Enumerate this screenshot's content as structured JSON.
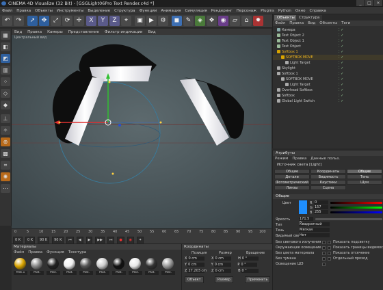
{
  "window": {
    "title": "CINEMA 4D Visualize (32 Bit) - [GSGLight06Pro Text Render.c4d *]",
    "buttons": [
      "_",
      "□",
      "×"
    ]
  },
  "menubar": [
    "Файл",
    "Правка",
    "Объекты",
    "Инструменты",
    "Выделение",
    "Структура",
    "Функции",
    "Анимация",
    "Симуляция",
    "Рендеринг",
    "Персонаж",
    "Plugins",
    "Python",
    "Окно",
    "Справка"
  ],
  "toolbar": {
    "icons": [
      "undo-icon",
      "redo-icon",
      "select-icon",
      "move-icon",
      "scale-icon",
      "rotate-icon",
      "recent-icon",
      "x-axis-icon",
      "y-axis-icon",
      "z-axis-icon",
      "coord-icon",
      "render-region-icon",
      "render-view-icon",
      "render-settings-icon",
      "cube-icon",
      "pen-icon",
      "subdiv-icon",
      "array-icon",
      "deformer-icon",
      "floor-icon",
      "camera-icon",
      "light-icon"
    ],
    "axis_labels": [
      "X",
      "Y",
      "Z"
    ]
  },
  "left_tools": [
    "make-editable-icon",
    "model-mode-icon",
    "texture-mode-icon",
    "workplane-icon",
    "points-icon",
    "edges-icon",
    "polygons-icon",
    "axis-icon",
    "tweak-icon",
    "snap-icon",
    "solo-icon",
    "quantize-icon",
    "live-select-icon",
    "misc-icon"
  ],
  "viewport": {
    "menu": [
      "Вид",
      "Правка",
      "Камеры",
      "Представление",
      "Фильтр индикации",
      "Вид"
    ],
    "label": "Центральный вид"
  },
  "timeline": {
    "ticks": [
      "0",
      "5",
      "10",
      "15",
      "20",
      "25",
      "30",
      "35",
      "40",
      "45",
      "50",
      "55",
      "60",
      "65",
      "70",
      "75",
      "80",
      "85",
      "90",
      "95",
      "100"
    ],
    "start": "0 K",
    "current": "0 K",
    "end": "90 K",
    "end2": "90 K"
  },
  "materials": {
    "title": "Материалы",
    "menu": [
      "Файл",
      "Правка",
      "Функция",
      "Текстура"
    ],
    "items": [
      {
        "name": "Mat.1",
        "color": "#d9a400"
      },
      {
        "name": "Mat.",
        "color": "#888888"
      },
      {
        "name": "Mat.",
        "color": "#222222"
      },
      {
        "name": "Mat.",
        "color": "#f0f0f0"
      },
      {
        "name": "Mat.",
        "color": "#555555"
      },
      {
        "name": "Mat.",
        "color": "#cccccc"
      },
      {
        "name": "Mat.",
        "color": "#111111"
      },
      {
        "name": "Mat.",
        "color": "#e8e8e8"
      },
      {
        "name": "Mat.",
        "color": "#333333"
      },
      {
        "name": "Mat.",
        "color": "#999999"
      }
    ]
  },
  "coordinates": {
    "title": "Координаты",
    "columns": [
      "Позиция",
      "Размер",
      "Вращение"
    ],
    "rows": [
      {
        "axis": "X",
        "pos": "0 cm",
        "size": "0 cm",
        "rot_axis": "H",
        "rot": "0 °"
      },
      {
        "axis": "Y",
        "pos": "0 cm",
        "size": "0 cm",
        "rot_axis": "P",
        "rot": "0 °"
      },
      {
        "axis": "Z",
        "pos": "27.203 cm",
        "size": "0 cm",
        "rot_axis": "B",
        "rot": "0 °"
      }
    ],
    "mode1": "Объект",
    "mode2": "Размер",
    "apply": "Применить"
  },
  "objects": {
    "tabs": [
      "Объекты",
      "Структура"
    ],
    "menu": [
      "Файл",
      "Правка",
      "Вид",
      "Объекты",
      "Теги"
    ],
    "rows": [
      {
        "name": "Камера",
        "indent": 0,
        "color": "#8aa"
      },
      {
        "name": "Text Object 2",
        "indent": 0,
        "color": "#9b9"
      },
      {
        "name": "Text Object 1",
        "indent": 0,
        "color": "#9b9"
      },
      {
        "name": "Text Object",
        "indent": 0,
        "color": "#9b9"
      },
      {
        "name": "Softbox 1",
        "indent": 0,
        "color": "#d9a400",
        "highlight": true
      },
      {
        "name": "SOFTBOX MOVE",
        "indent": 1,
        "color": "#d9a400",
        "selected": true
      },
      {
        "name": "Light Target",
        "indent": 2,
        "color": "#aaa"
      },
      {
        "name": "Skylight",
        "indent": 0,
        "color": "#aaa"
      },
      {
        "name": "Softbox 1",
        "indent": 0,
        "color": "#aaa"
      },
      {
        "name": "SOFTBOX MOVE",
        "indent": 1,
        "color": "#aaa"
      },
      {
        "name": "Light Target",
        "indent": 2,
        "color": "#aaa"
      },
      {
        "name": "Overhead Softbox",
        "indent": 0,
        "color": "#aaa"
      },
      {
        "name": "Softbox",
        "indent": 0,
        "color": "#aaa"
      },
      {
        "name": "Global Light Switch",
        "indent": 0,
        "color": "#aaa"
      }
    ]
  },
  "attributes": {
    "title": "Атрибуты",
    "menu": [
      "Режим",
      "Правка",
      "Данные польз."
    ],
    "object": "Источник света [Light]",
    "tabs": [
      [
        "Общие",
        "Координаты",
        "Общие"
      ],
      [
        "Детали",
        "Видимость",
        "Тень"
      ],
      [
        "Фотометрический",
        "Каустики",
        "Шум"
      ],
      [
        "Линзы",
        "Сцена",
        ""
      ]
    ],
    "section": "Общие",
    "color_label": "Цвет",
    "rgb": [
      {
        "ch": "R",
        "val": "0"
      },
      {
        "ch": "G",
        "val": "157"
      },
      {
        "ch": "B",
        "val": "255"
      }
    ],
    "color_fill": "#1f8fff",
    "intensity_label": "Яркость",
    "intensity": "171.5 %",
    "type_label": "Тип",
    "type": "Квадратный",
    "shadow_label": "Тень",
    "shadow": "Мягкая",
    "visible_label": "Видимый свет",
    "visible": "Нет",
    "checks_left": [
      "Без светового излучения",
      "Окружающее освещение",
      "Без цвета материала",
      "Без тумана",
      "Освещение ШЭ"
    ],
    "checks_right": [
      "Показать подсветку",
      "Показать границы видимости",
      "Показать отсечение",
      "Отдельный проход"
    ]
  }
}
